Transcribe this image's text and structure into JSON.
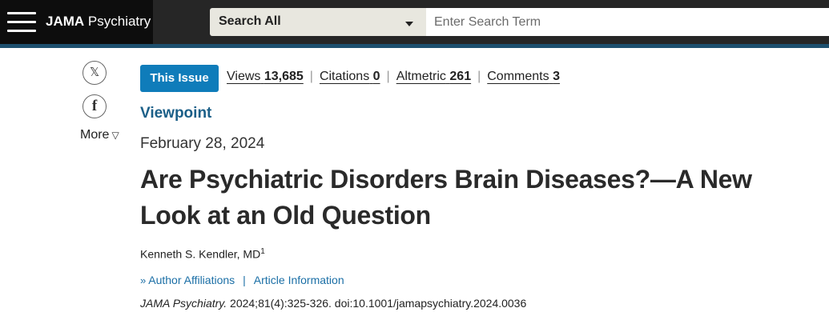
{
  "header": {
    "brand_bold": "JAMA",
    "brand_rest": " Psychiatry",
    "search_scope": "Search All",
    "search_placeholder": "Enter Search Term"
  },
  "share": {
    "x_glyph": "𝕏",
    "fb_glyph": "f",
    "more_label": "More",
    "more_glyph": "▽"
  },
  "metrics": {
    "issue_button": "This Issue",
    "views_label": "Views",
    "views_value": "13,685",
    "citations_label": "Citations",
    "citations_value": "0",
    "altmetric_label": "Altmetric",
    "altmetric_value": "261",
    "comments_label": "Comments",
    "comments_value": "3",
    "separator": "|"
  },
  "article": {
    "category": "Viewpoint",
    "date": "February 28, 2024",
    "title": "Are Psychiatric Disorders Brain Diseases?—A New Look at an Old Question",
    "author": "Kenneth S. Kendler, MD",
    "author_sup": "1",
    "affiliations_glyph": "»",
    "affiliations_label": "Author Affiliations",
    "link_separator": "|",
    "article_info_label": "Article Information",
    "journal": "JAMA Psychiatry.",
    "citation": " 2024;81(4):325-326. doi:10.1001/jamapsychiatry.2024.0036"
  },
  "colors": {
    "topbar": "#262626",
    "brand_bg": "#0d0d0d",
    "accent_line": "#1d4f6e",
    "issue_button": "#0f7cba",
    "category": "#1b5f88",
    "link": "#1b6fa6"
  },
  "icons": [
    "menu-icon",
    "chevron-down-icon",
    "x-social-icon",
    "facebook-icon",
    "triangle-down-icon",
    "double-chevron-right-icon"
  ]
}
